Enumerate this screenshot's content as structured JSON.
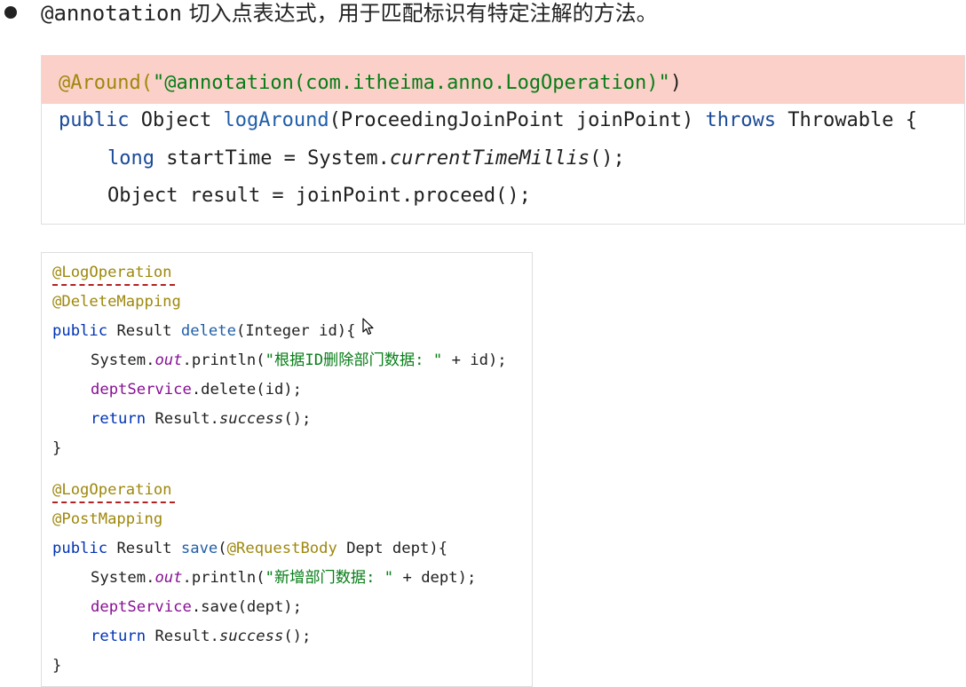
{
  "bullet": {
    "code": "@annotation",
    "text": " 切入点表达式，用于匹配标识有特定注解的方法。"
  },
  "snippet1": {
    "line1": {
      "annotation": "@Around(",
      "string": "\"@annotation(com.itheima.anno.LogOperation)\"",
      "close": ")"
    },
    "line2": {
      "kw_public": "public",
      "type": " Object ",
      "method": "logAround",
      "params": "(ProceedingJoinPoint joinPoint) ",
      "kw_throws": "throws",
      "rest": " Throwable {"
    },
    "line3": {
      "kw_long": "long",
      "pre": " startTime = System.",
      "method": "currentTimeMillis",
      "post": "();"
    },
    "line4": {
      "text": "Object result = joinPoint.proceed();"
    }
  },
  "snippet2": {
    "block1": {
      "ann1": "@LogOperation",
      "ann2": "@DeleteMapping",
      "sig_public": "public",
      "sig_type": " Result ",
      "sig_method": "delete",
      "sig_params": "(Integer id){",
      "print_pre": "System.",
      "print_out": "out",
      "print_mid": ".println(",
      "print_str": "\"根据ID删除部门数据: \"",
      "print_post": " + id);",
      "svc_field": "deptService",
      "svc_call": ".delete(id);",
      "ret_kw": "return",
      "ret_pre": " Result.",
      "ret_method": "success",
      "ret_post": "();",
      "close": "}"
    },
    "block2": {
      "ann1": "@LogOperation",
      "ann2": "@PostMapping",
      "sig_public": "public",
      "sig_type": " Result ",
      "sig_method": "save",
      "sig_paren": "(",
      "sig_ann": "@RequestBody",
      "sig_params": " Dept dept){",
      "print_pre": "System.",
      "print_out": "out",
      "print_mid": ".println(",
      "print_str": "\"新增部门数据: \"",
      "print_post": " + dept);",
      "svc_field": "deptService",
      "svc_call": ".save(dept);",
      "ret_kw": "return",
      "ret_pre": " Result.",
      "ret_method": "success",
      "ret_post": "();",
      "close": "}"
    }
  },
  "colors": {
    "keyword": "#0033b3",
    "annotation": "#9e880d",
    "string": "#067d17",
    "field": "#871094",
    "highlight": "#fbd0c8",
    "squiggle": "#b22222"
  }
}
